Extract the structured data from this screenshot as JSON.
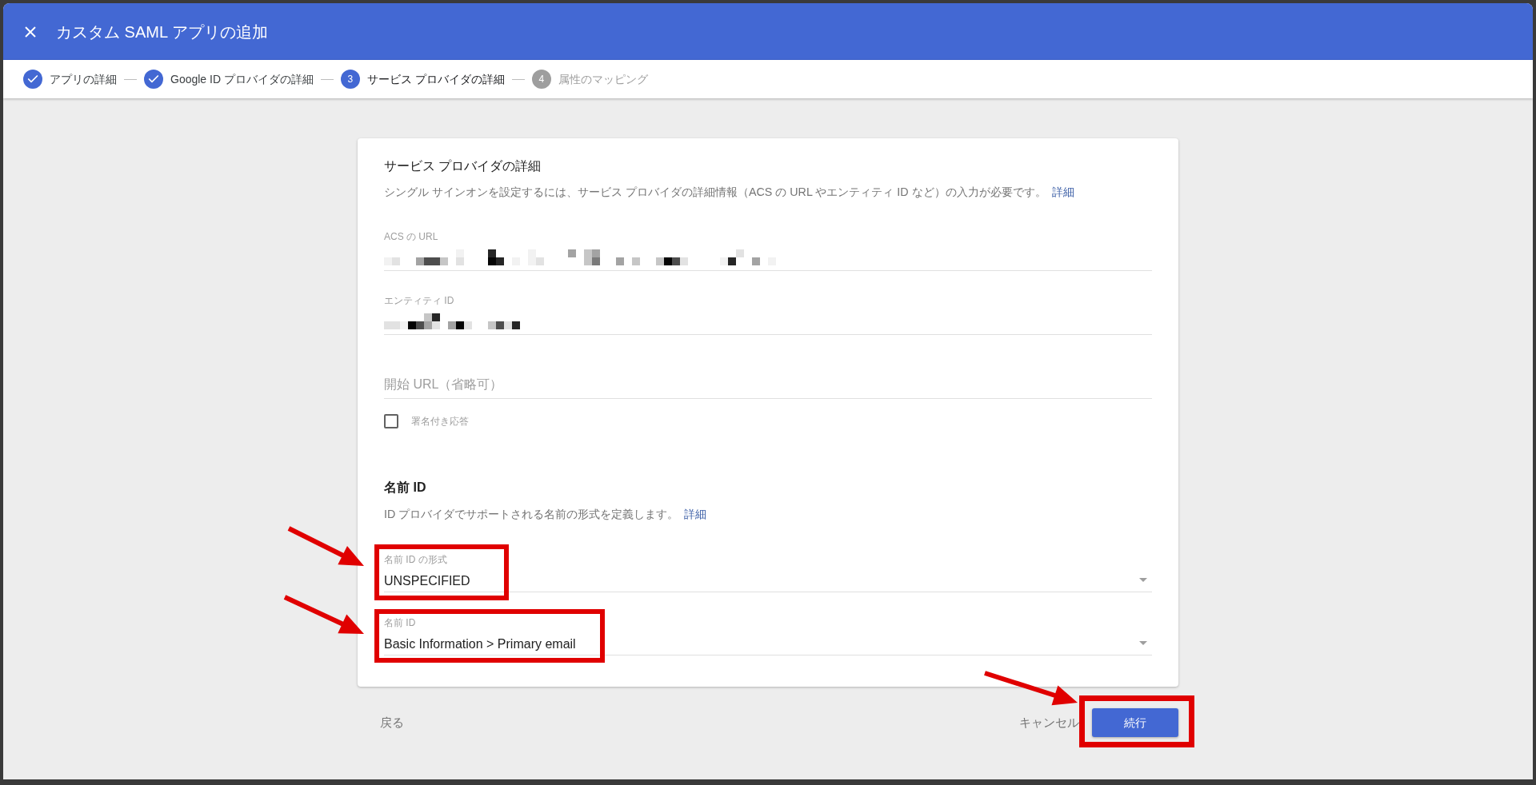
{
  "window": {
    "title": "カスタム SAML アプリの追加"
  },
  "stepper": [
    {
      "label": "アプリの詳細",
      "completed": true,
      "selected": false
    },
    {
      "label": "Google ID プロバイダの詳細",
      "completed": true,
      "selected": false
    },
    {
      "label": "サービス プロバイダの詳細",
      "completed": false,
      "selected": true,
      "number": "3"
    },
    {
      "label": "属性のマッピング",
      "completed": false,
      "selected": false,
      "number": "4"
    }
  ],
  "service_provider": {
    "title": "サービス プロバイダの詳細",
    "description": "シングル サインオンを設定するには、サービス プロバイダの詳細情報（ACS の URL やエンティティ ID など）の入力が必要です。",
    "link": "詳細",
    "fields": [
      {
        "kind": "text",
        "label": "ACS の URL",
        "redacted": true
      },
      {
        "kind": "text",
        "label": "エンティティ ID",
        "redacted": true
      },
      {
        "kind": "input",
        "placeholder": "開始 URL（省略可）"
      },
      {
        "kind": "checkbox",
        "label": "署名付き応答",
        "checked": false
      }
    ]
  },
  "name_id": {
    "title": "名前 ID",
    "description": "ID プロバイダでサポートされる名前の形式を定義します。",
    "link": "詳細",
    "fields": [
      {
        "kind": "select",
        "label": "名前 ID の形式",
        "value": "UNSPECIFIED",
        "highlighted": true
      },
      {
        "kind": "select",
        "label": "名前 ID",
        "value": "Basic Information > Primary email",
        "highlighted": true
      }
    ]
  },
  "footer": {
    "back": "戻る",
    "cancel": "キャンセル",
    "continue": {
      "label": "続行",
      "highlighted": true
    }
  }
}
